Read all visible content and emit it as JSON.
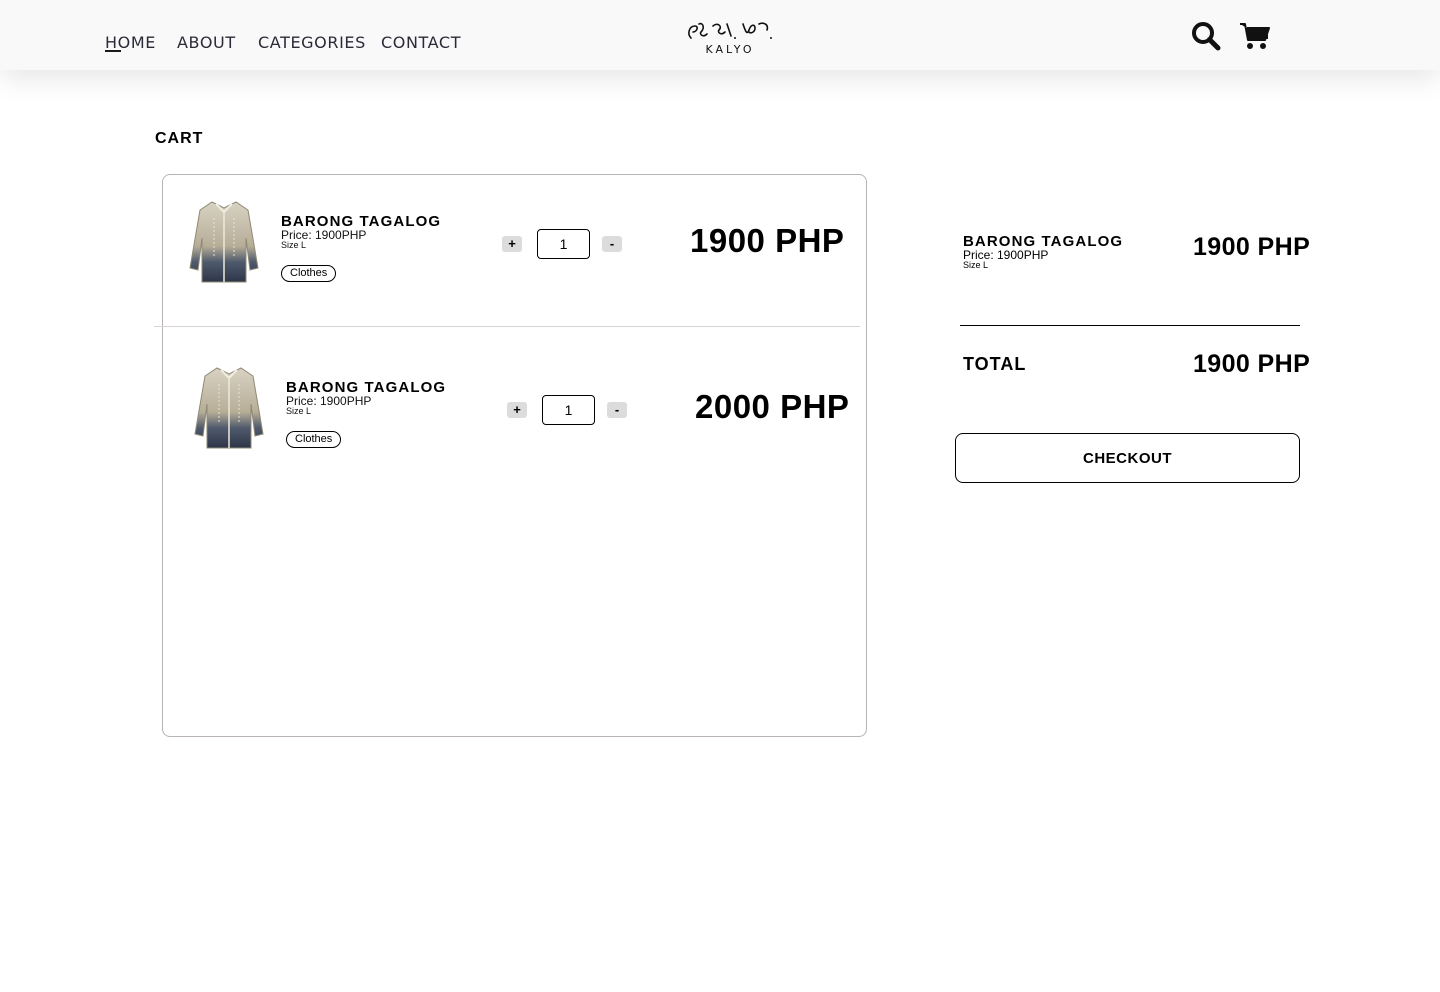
{
  "nav": {
    "home": "HOME",
    "about": "ABOUT",
    "categories": "CATEGORIES",
    "contact": "CONTACT",
    "logo_text": "KALYO",
    "icons": [
      "search-icon",
      "cart-icon"
    ]
  },
  "cart": {
    "title": "CART",
    "items": [
      {
        "name": "BARONG TAGALOG",
        "price": "Price: 1900PHP",
        "size": "Size L",
        "tag": "Clothes",
        "qty_plus": "+",
        "qty_value": "1",
        "qty_minus": "-",
        "total": "1900 PHP"
      },
      {
        "name": "BARONG TAGALOG",
        "price": "Price: 1900PHP",
        "size": "Size L",
        "tag": "Clothes",
        "qty_plus": "+",
        "qty_value": "1",
        "qty_minus": "-",
        "total": "2000 PHP"
      }
    ]
  },
  "summary": {
    "item_name": "BARONG TAGALOG",
    "item_price": "Price: 1900PHP",
    "item_size": "Size L",
    "item_amount": "1900 PHP",
    "total_label": "TOTAL",
    "total_amount": "1900 PHP",
    "checkout_label": "CHECKOUT"
  }
}
